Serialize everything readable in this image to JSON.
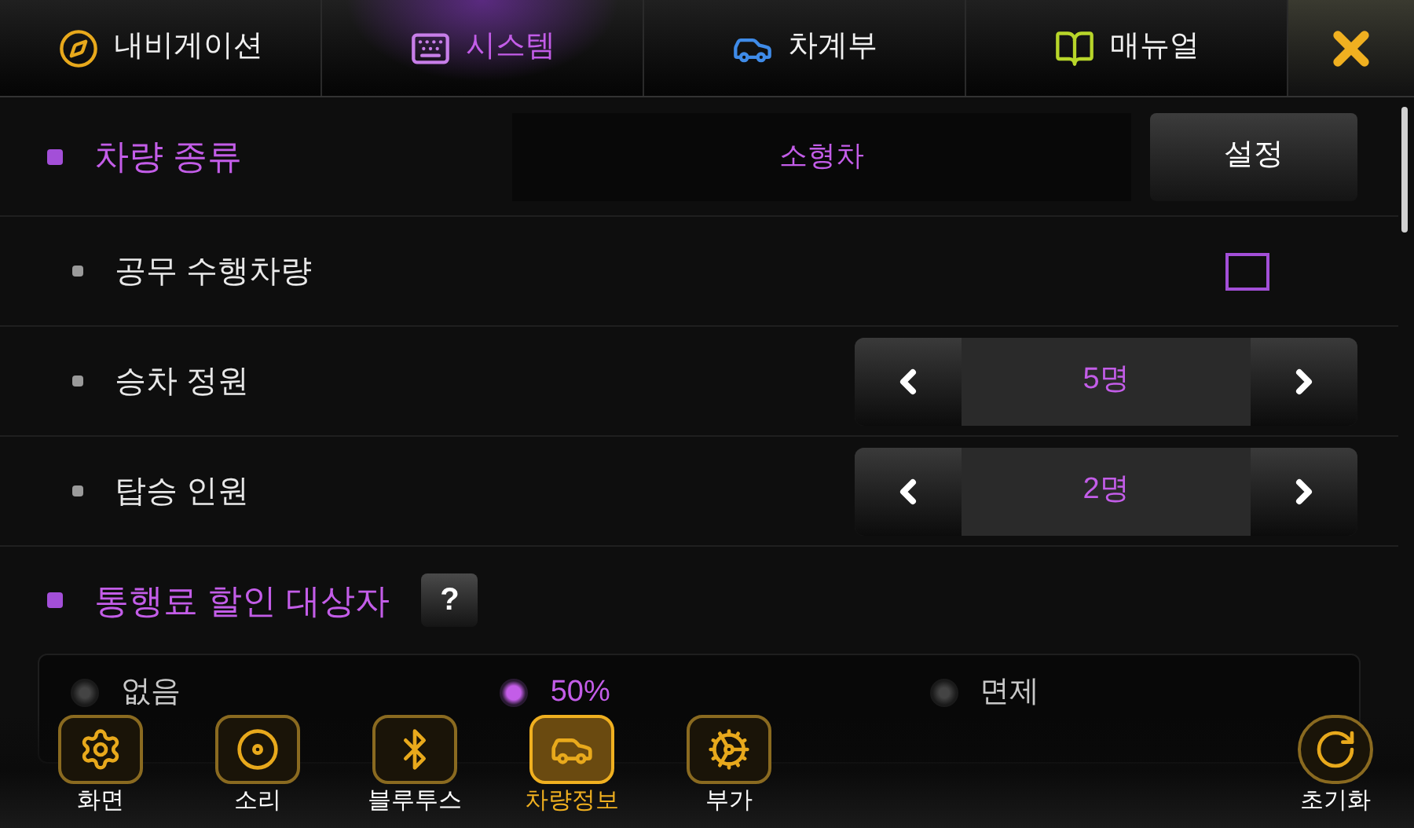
{
  "tabs": [
    {
      "label": "내비게이션",
      "selected": false
    },
    {
      "label": "시스템",
      "selected": true
    },
    {
      "label": "차계부",
      "selected": false
    },
    {
      "label": "매뉴얼",
      "selected": false
    }
  ],
  "vehicle_type": {
    "label": "차량 종류",
    "value": "소형차",
    "button": "설정"
  },
  "options": [
    {
      "kind": "checkbox",
      "label": "공무 수행차량",
      "checked": false
    },
    {
      "kind": "stepper",
      "label": "승차 정원",
      "value": "5명"
    },
    {
      "kind": "stepper",
      "label": "탑승 인원",
      "value": "2명"
    }
  ],
  "toll": {
    "label": "통행료 할인 대상자",
    "help": "?",
    "choices": [
      {
        "label": "없음",
        "selected": false
      },
      {
        "label": "50%",
        "selected": true
      },
      {
        "label": "면제",
        "selected": false
      }
    ]
  },
  "dock": [
    {
      "label": "화면",
      "selected": false
    },
    {
      "label": "소리",
      "selected": false
    },
    {
      "label": "블루투스",
      "selected": false
    },
    {
      "label": "차량정보",
      "selected": true
    },
    {
      "label": "부가",
      "selected": false
    }
  ],
  "reset": {
    "label": "초기화"
  }
}
